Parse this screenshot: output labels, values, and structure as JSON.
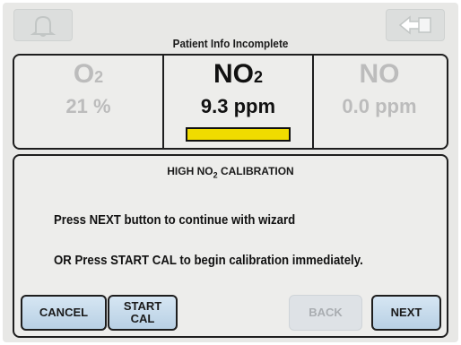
{
  "header": {
    "title": "Patient Info Incomplete",
    "left_icon": "bell-icon",
    "right_icon": "back-arrow-icon"
  },
  "gases": [
    {
      "name": "O",
      "sub": "2",
      "value": "21 %",
      "active": false
    },
    {
      "name": "NO",
      "sub": "2",
      "value": "9.3 ppm",
      "active": true,
      "level_fraction": 1.0,
      "level_color": "#f0dc00"
    },
    {
      "name": "NO",
      "sub": "",
      "value": "0.0 ppm",
      "active": false
    }
  ],
  "message": {
    "title_prefix": "HIGH NO",
    "title_sub": "2",
    "title_suffix": " CALIBRATION",
    "line1": "Press NEXT button to continue with wizard",
    "line2": "OR Press START CAL to begin calibration immediately."
  },
  "buttons": {
    "cancel": "CANCEL",
    "start_cal": "START\nCAL",
    "back": "BACK",
    "next": "NEXT"
  },
  "colors": {
    "screen_bg": "#e8e8e6",
    "button_bg": "#c8dbeb",
    "inactive_text": "#bcbcbc",
    "level_fill": "#f0dc00"
  }
}
